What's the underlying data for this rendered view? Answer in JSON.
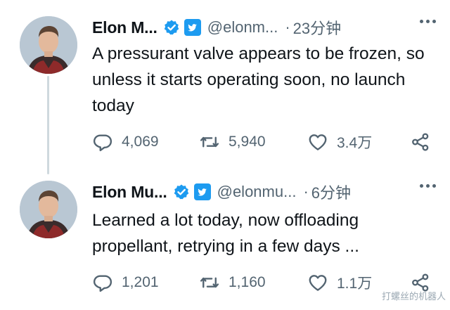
{
  "tweets": [
    {
      "name": "Elon M...",
      "handle": "@elonm...",
      "separator": "·",
      "time": "23分钟",
      "text": "A pressurant valve appears to be frozen, so unless it starts operating soon, no launch today",
      "replies": "4,069",
      "retweets": "5,940",
      "likes": "3.4万"
    },
    {
      "name": "Elon Mu...",
      "handle": "@elonmu...",
      "separator": "·",
      "time": "6分钟",
      "text": "Learned a lot today, now offloading propellant, retrying in a few days ...",
      "replies": "1,201",
      "retweets": "1,160",
      "likes": "1.1万"
    }
  ],
  "watermark": "打螺丝的机器人",
  "colors": {
    "accent": "#1d9bf0",
    "secondary_text": "#536471",
    "primary_text": "#0f1419",
    "thread_line": "#cfd9de"
  },
  "icons": [
    "verified-badge-icon",
    "twitter-bird-icon",
    "more-icon",
    "reply-icon",
    "retweet-icon",
    "like-icon",
    "share-icon"
  ]
}
